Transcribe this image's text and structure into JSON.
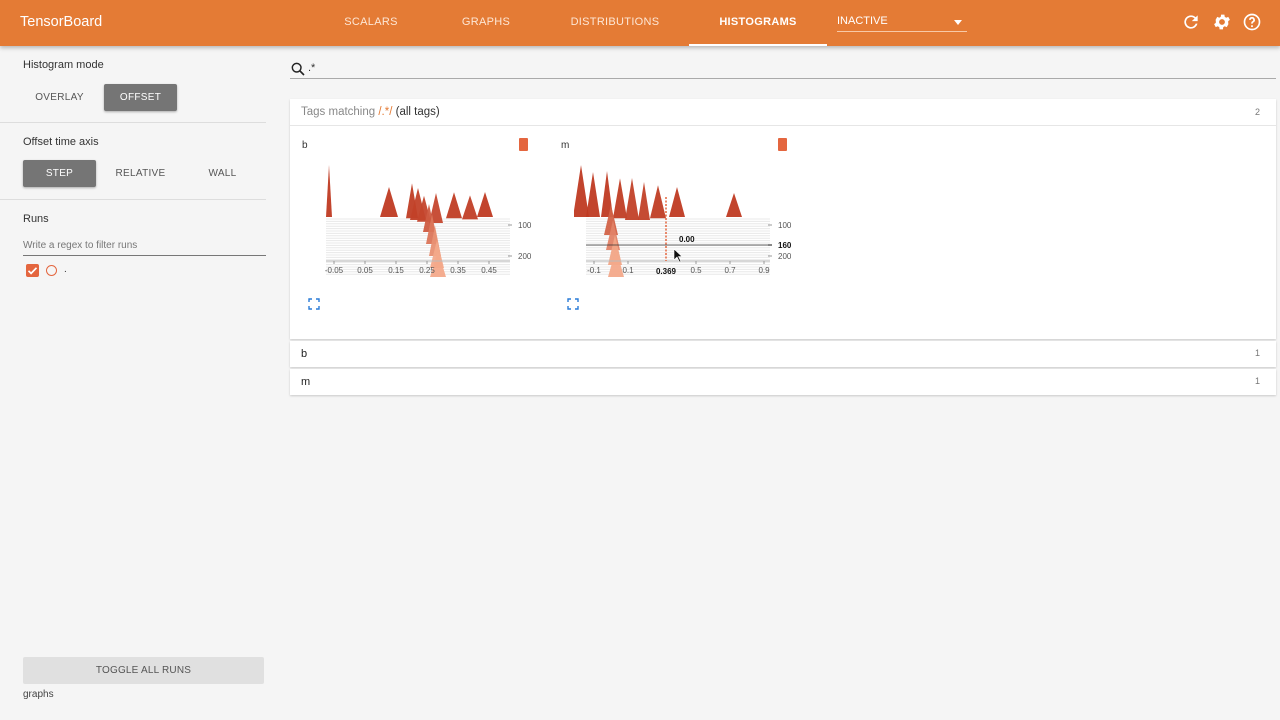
{
  "header": {
    "brand": "TensorBoard",
    "tabs": [
      {
        "label": "SCALARS"
      },
      {
        "label": "GRAPHS"
      },
      {
        "label": "DISTRIBUTIONS"
      },
      {
        "label": "HISTOGRAMS"
      }
    ],
    "active_tab": "HISTOGRAMS",
    "inactive_select": "INACTIVE",
    "icons": [
      "refresh-icon",
      "settings-icon",
      "help-icon"
    ]
  },
  "sidebar": {
    "histogram_mode": {
      "title": "Histogram mode",
      "options": [
        "OVERLAY",
        "OFFSET"
      ],
      "selected": "OFFSET"
    },
    "offset_time_axis": {
      "title": "Offset time axis",
      "options": [
        "STEP",
        "RELATIVE",
        "WALL"
      ],
      "selected": "STEP"
    },
    "runs": {
      "title": "Runs",
      "filter_placeholder": "Write a regex to filter runs",
      "items": [
        {
          "label": ".",
          "checked": true
        }
      ]
    },
    "toggle_all_label": "TOGGLE ALL RUNS",
    "footer": "graphs"
  },
  "main": {
    "search_value": ".*",
    "tag_group": {
      "prefix": "Tags matching ",
      "pattern": "/.*/",
      "suffix": " (all tags)",
      "count": "2"
    },
    "charts": [
      {
        "title": "b",
        "x_ticks": [
          "-0.05",
          "0.05",
          "0.15",
          "0.25",
          "0.35",
          "0.45"
        ],
        "y_ticks": [
          "100",
          "200"
        ]
      },
      {
        "title": "m",
        "x_ticks": [
          "-0.1",
          "0.1",
          "0.5",
          "0.7",
          "0.9"
        ],
        "y_ticks": [
          "100",
          "200"
        ],
        "hover": {
          "x_value": "0.369",
          "y_value": "0.00",
          "step": "160"
        }
      }
    ],
    "collapsed_groups": [
      {
        "title": "b",
        "count": "1"
      },
      {
        "title": "m",
        "count": "1"
      }
    ]
  },
  "colors": {
    "accent": "#e47b35",
    "run": "#e4663f",
    "histogram_dark": "#bf3a22",
    "histogram_light": "#f3a98a"
  }
}
